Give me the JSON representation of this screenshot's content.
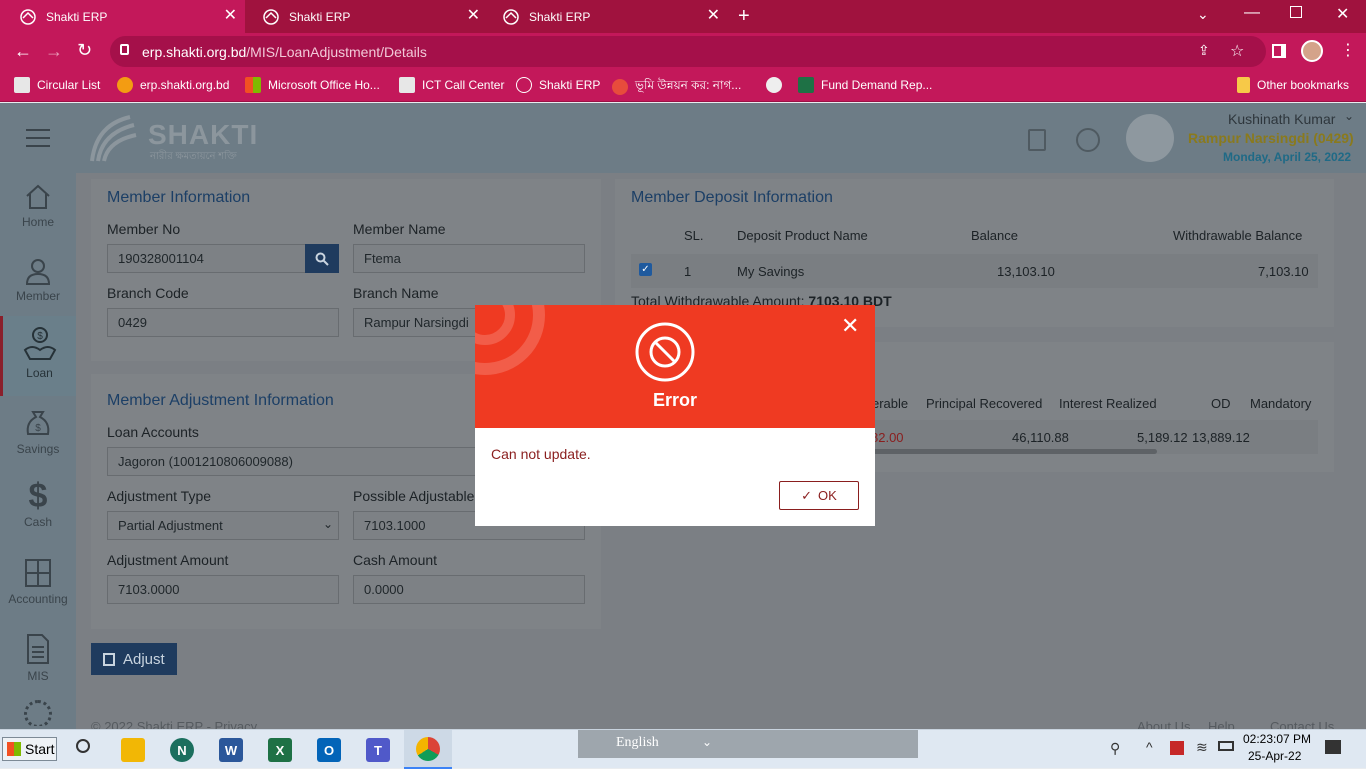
{
  "browser": {
    "tabs": [
      {
        "title": "Shakti ERP",
        "active": true
      },
      {
        "title": "Shakti ERP",
        "active": false
      },
      {
        "title": "Shakti ERP",
        "active": false
      }
    ],
    "url_domain": "erp.shakti.org.bd",
    "url_path": "/MIS/LoanAdjustment/Details",
    "bookmarks": [
      "Circular List",
      "erp.shakti.org.bd",
      "Microsoft Office Ho...",
      "ICT Call Center",
      "Shakti ERP",
      "ভূমি উন্নয়ন কর: নাগ...",
      "Fund Demand Rep...",
      "Other bookmarks"
    ],
    "colors": {
      "tab_bar": "#a0123e",
      "toolbar": "#c3185a"
    }
  },
  "header": {
    "brand": "SHAKTI",
    "brand_tagline": "নারীর ক্ষমতায়নে শক্তি",
    "user_name": "Kushinath Kumar",
    "branch": "Rampur Narsingdi (0429)",
    "date": "Monday, April 25, 2022"
  },
  "sidebar": {
    "items": [
      {
        "label": "Home",
        "icon": "home-icon"
      },
      {
        "label": "Member",
        "icon": "user-icon"
      },
      {
        "label": "Loan",
        "icon": "loan-icon"
      },
      {
        "label": "Savings",
        "icon": "money-bag-icon"
      },
      {
        "label": "Cash",
        "icon": "dollar-icon"
      },
      {
        "label": "Accounting",
        "icon": "calculator-icon"
      },
      {
        "label": "MIS",
        "icon": "report-icon"
      }
    ]
  },
  "member_info": {
    "title": "Member Information",
    "member_no_label": "Member No",
    "member_no": "190328001104",
    "member_name_label": "Member Name",
    "member_name": "Ftema",
    "branch_code_label": "Branch Code",
    "branch_code": "0429",
    "branch_name_label": "Branch Name",
    "branch_name": "Rampur Narsingdi"
  },
  "adjustment": {
    "title": "Member Adjustment Information",
    "loan_accounts_label": "Loan Accounts",
    "loan_account": "Jagoron (1001210806009088)",
    "adjustment_type_label": "Adjustment Type",
    "adjustment_type": "Partial Adjustment",
    "possible_label": "Possible Adjustable",
    "possible_value": "7103.1000",
    "amount_label": "Adjustment Amount",
    "amount_value": "7103.0000",
    "cash_label": "Cash Amount",
    "cash_value": "0.0000",
    "adjust_button": "Adjust"
  },
  "deposit": {
    "title": "Member Deposit Information",
    "headers": [
      "SL.",
      "Deposit Product Name",
      "Balance",
      "Withdrawable Balance"
    ],
    "rows": [
      {
        "sl": "1",
        "product": "My Savings",
        "balance": "13,103.10",
        "withdrawable": "7,103.10"
      }
    ],
    "total_label": "Total Withdrawable Amount:",
    "total_value": "7103.10 BDT"
  },
  "loan_table": {
    "headers": [
      "erable",
      "Principal Recovered",
      "Interest Realized",
      "OD",
      "Mandatory"
    ],
    "row": {
      "c1": "82.00",
      "principal": "46,110.88",
      "interest": "5,189.12",
      "od": "13,889.12"
    }
  },
  "footer": {
    "copyright": "© 2022 Shakti ERP - Privacy",
    "about": "About Us",
    "help": "Help",
    "contact": "Contact Us"
  },
  "modal": {
    "title": "Error",
    "message": "Can not update.",
    "ok_label": "OK",
    "head_color": "#ef3a22"
  },
  "taskbar": {
    "start": "Start",
    "language": "English",
    "time": "02:23:07 PM",
    "date": "25-Apr-22"
  }
}
